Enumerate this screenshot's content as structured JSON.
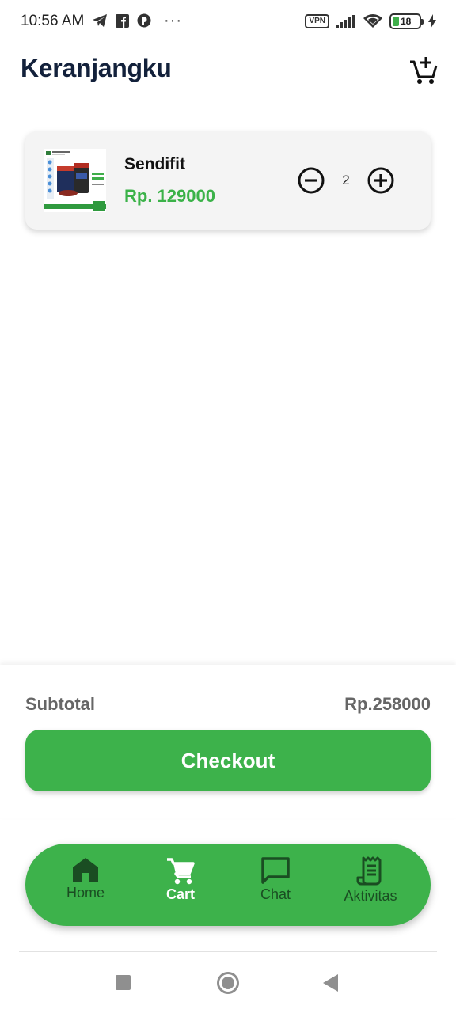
{
  "status_bar": {
    "time": "10:56 AM",
    "vpn_label": "VPN",
    "battery_level": "18",
    "icons": [
      "telegram-icon",
      "facebook-icon",
      "app-icon",
      "more-dots-icon",
      "signal-icon",
      "wifi-icon",
      "battery-icon",
      "charging-icon"
    ]
  },
  "header": {
    "title": "Keranjangku",
    "action_icon": "add-to-cart-icon"
  },
  "cart": {
    "items": [
      {
        "name": "Sendifit",
        "price": "Rp. 129000",
        "quantity": "2",
        "thumbnail": "product-image"
      }
    ]
  },
  "summary": {
    "subtotal_label": "Subtotal",
    "subtotal_value": "Rp.258000",
    "checkout_label": "Checkout"
  },
  "bottom_nav": {
    "items": [
      {
        "label": "Home",
        "icon": "home-icon",
        "active": false
      },
      {
        "label": "Cart",
        "icon": "cart-icon",
        "active": true
      },
      {
        "label": "Chat",
        "icon": "chat-icon",
        "active": false
      },
      {
        "label": "Aktivitas",
        "icon": "receipt-icon",
        "active": false
      }
    ]
  },
  "colors": {
    "accent_green": "#3db24b",
    "title_navy": "#13213b",
    "nav_inactive": "#1a4d22"
  }
}
